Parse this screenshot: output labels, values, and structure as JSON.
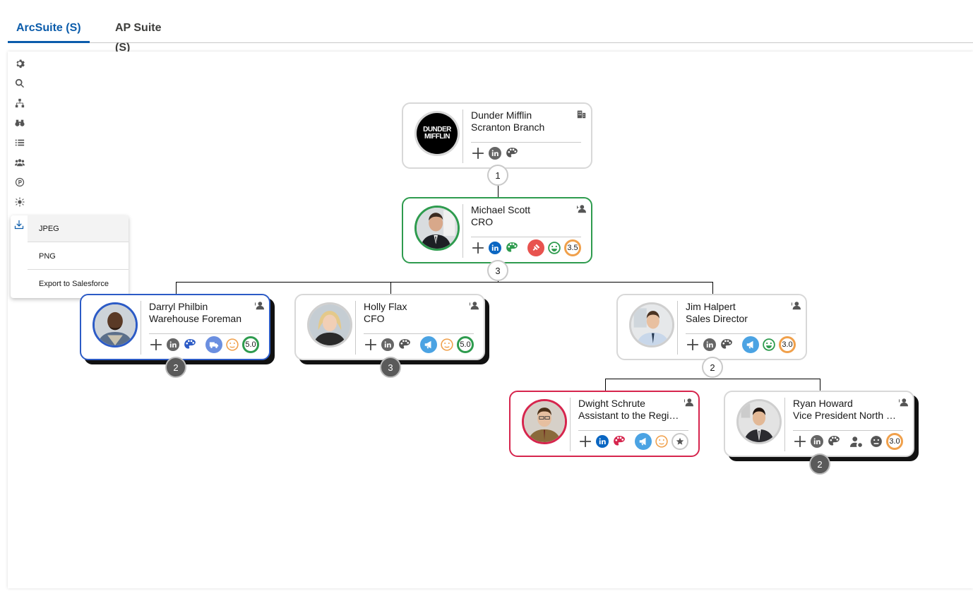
{
  "tabs": [
    {
      "label": "ArcSuite (S)",
      "active": true
    },
    {
      "label": "AP Suite (S)",
      "active": false
    }
  ],
  "toolbar": {
    "items": [
      "settings-icon",
      "search-icon",
      "hierarchy-icon",
      "binoculars-icon",
      "list-icon",
      "team-icon",
      "p-icon",
      "sun-icon",
      "download-icon"
    ]
  },
  "export_menu": {
    "items": [
      "JPEG",
      "PNG",
      "Export to Salesforce"
    ]
  },
  "logo": {
    "line1": "DUNDER",
    "line2": "MIFFLIN"
  },
  "nodes": {
    "root": {
      "name": "Dunder Mifflin",
      "title": "Scranton Branch",
      "count": "1"
    },
    "michael": {
      "name": "Michael Scott",
      "title": "CRO",
      "rating": "3.5",
      "count": "3"
    },
    "darryl": {
      "name": "Darryl Philbin",
      "title": "Warehouse Foreman",
      "rating": "5.0",
      "count": "2"
    },
    "holly": {
      "name": "Holly Flax",
      "title": "CFO",
      "rating": "5.0",
      "count": "3"
    },
    "jim": {
      "name": "Jim Halpert",
      "title": "Sales Director",
      "rating": "3.0",
      "count": "2"
    },
    "dwight": {
      "name": "Dwight Schrute",
      "title": "Assistant to the Regional Manager"
    },
    "ryan": {
      "name": "Ryan Howard",
      "title": "Vice President North East",
      "rating": "3.0",
      "count": "2"
    }
  },
  "colors": {
    "accent": "#0b5cab",
    "green": "#2e9b4e",
    "blue": "#2c5bc6",
    "red": "#d6254d",
    "orange": "#f0a04b",
    "linkedin": "#0a66c2",
    "megaphone": "#4ba3e3"
  }
}
